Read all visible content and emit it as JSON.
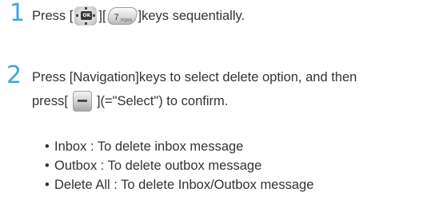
{
  "steps": [
    {
      "number": "1",
      "parts": {
        "press": "Press [",
        "between": "][",
        "after": "]keys sequentially."
      },
      "keys": [
        "navigation-ok-key-icon",
        "seven-pqrs-key-icon"
      ],
      "key7": {
        "digit": "7",
        "letters": "PQRS"
      },
      "nav_ok": "OK"
    },
    {
      "number": "2",
      "line1": "Press [Navigation]keys to select delete option, and then",
      "line2_before": "press[",
      "line2_after": "](=\"Select\") to confirm.",
      "keys": [
        "soft-key-icon"
      ]
    }
  ],
  "options": [
    "Inbox : To delete inbox message",
    "Outbox : To delete outbox message",
    "Delete All : To delete Inbox/Outbox message"
  ],
  "bullet_glyph": "•",
  "colors": {
    "step_number": "#3da6dd",
    "text": "#333333"
  }
}
